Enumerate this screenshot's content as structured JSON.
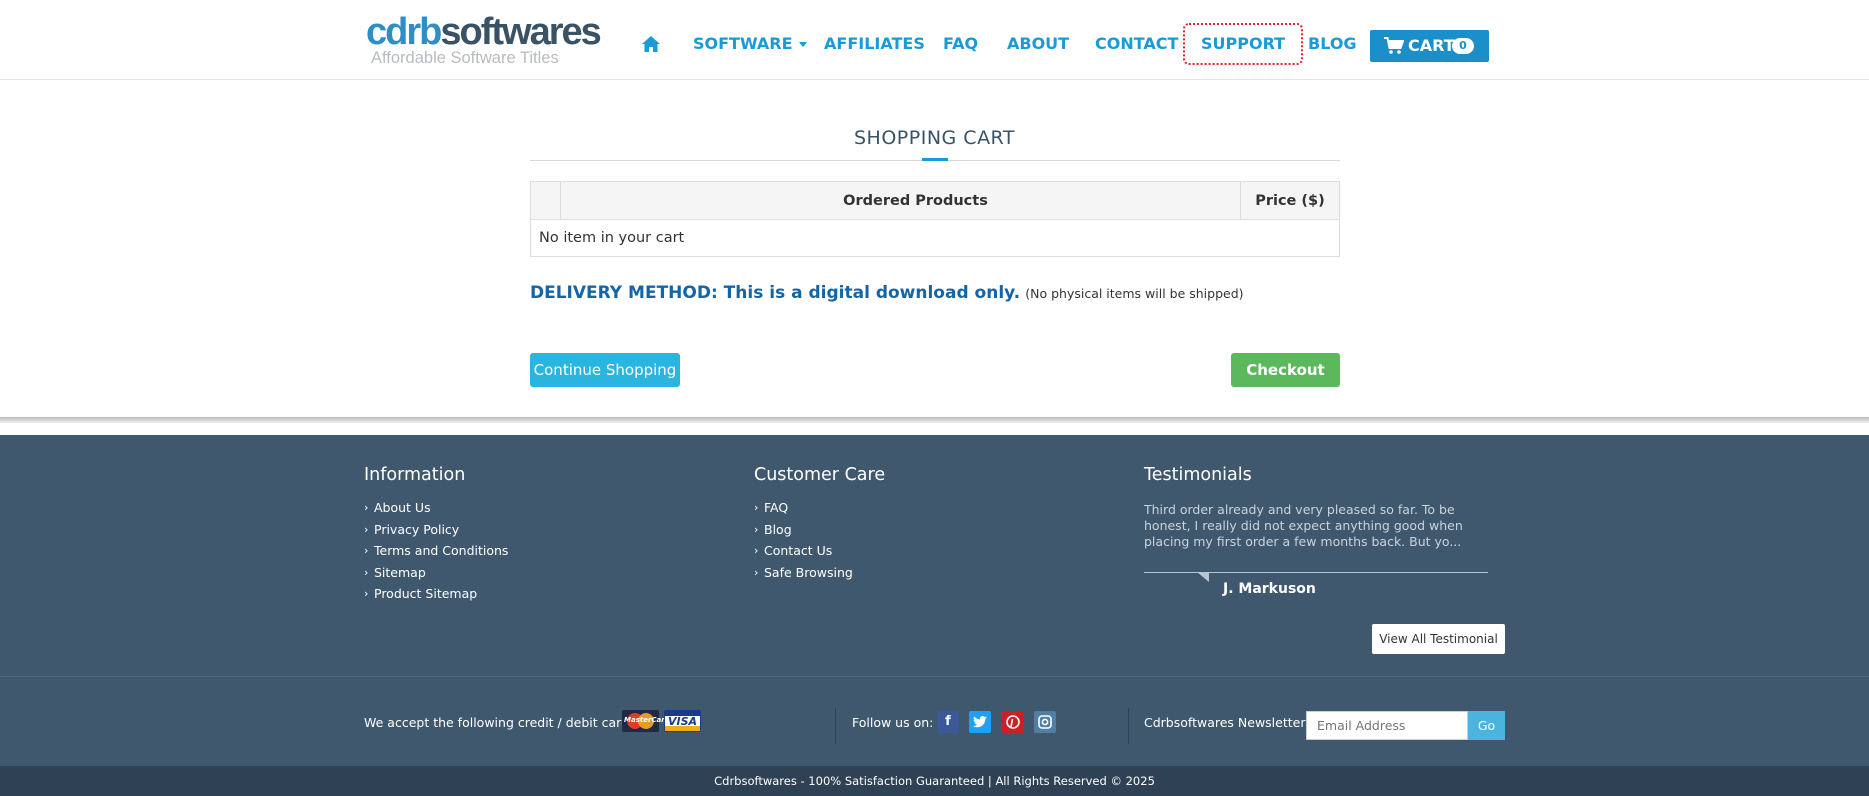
{
  "header": {
    "logo_part1": "cdrb",
    "logo_part2": "softwares",
    "logo_tagline": "Affordable Software Titles",
    "nav": {
      "home_icon": "home-icon",
      "software": "SOFTWARE",
      "affiliates": "AFFILIATES",
      "faq": "FAQ",
      "about": "ABOUT",
      "contact": "CONTACT",
      "support": "SUPPORT",
      "blog": "BLOG"
    },
    "cart": {
      "label": "CART",
      "count": "0",
      "icon": "shopping-cart-icon"
    }
  },
  "main": {
    "title": "SHOPPING CART",
    "table": {
      "headers": [
        "",
        "Ordered Products",
        "Price ($)"
      ],
      "empty_message": "No item in your cart"
    },
    "delivery_strong": "DELIVERY METHOD: This is a digital download only.",
    "delivery_note": "(No physical items will be shipped)",
    "continue_label": "Continue Shopping",
    "checkout_label": "Checkout"
  },
  "footer": {
    "information": {
      "title": "Information",
      "items": [
        "About Us",
        "Privacy Policy",
        "Terms and Conditions",
        "Sitemap",
        "Product Sitemap"
      ]
    },
    "customer_care": {
      "title": "Customer Care",
      "items": [
        "FAQ",
        "Blog",
        "Contact Us",
        "Safe Browsing"
      ]
    },
    "testimonials": {
      "title": "Testimonials",
      "text": "Third order already and very pleased so far. To be honest, I really did not expect anything good when placing my first order a few months back. But yo...",
      "author": "J. Markuson",
      "button": "View All Testimonial"
    },
    "payment_label": "We accept the following credit / debit cards:",
    "cards": [
      "MasterCard",
      "VISA"
    ],
    "follow_label": "Follow us on:",
    "social": [
      "facebook-icon",
      "twitter-icon",
      "pinterest-icon",
      "instagram-icon"
    ],
    "newsletter_label": "Cdrbsoftwares Newsletter:",
    "newsletter_placeholder": "Email Address",
    "go_label": "Go",
    "copyright": "Cdrbsoftwares - 100% Satisfaction Guaranteed | All Rights Reserved © 2025"
  },
  "colors": {
    "accent": "#1a9ad6",
    "checkout": "#5cb85c",
    "footer_bg": "#40586e"
  }
}
